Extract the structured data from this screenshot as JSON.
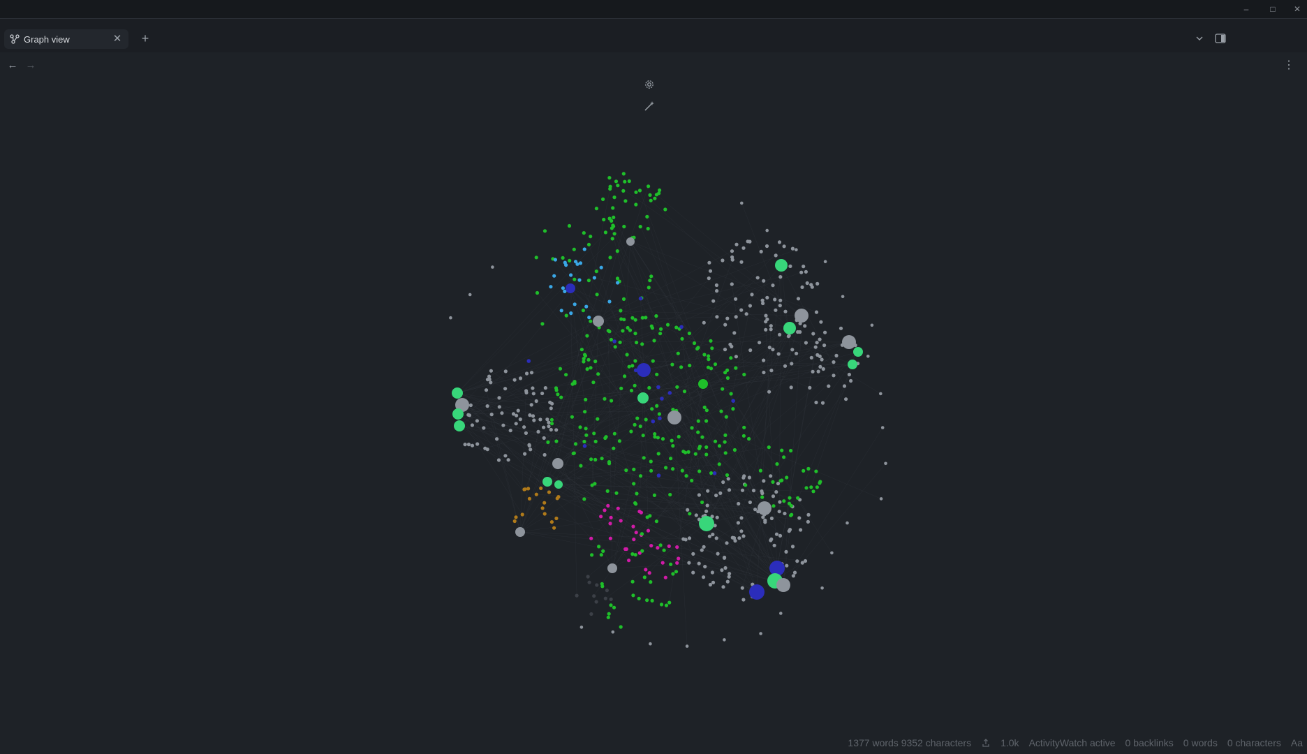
{
  "window": {
    "controls": {
      "minimize": "–",
      "maximize": "□",
      "close": "✕"
    }
  },
  "tabs": [
    {
      "title": "Graph view",
      "icon": "graph-icon",
      "close_symbol": "✕"
    }
  ],
  "tabbar": {
    "new_tab_symbol": "+",
    "dropdown_icon": "chevron-down-icon",
    "sidebar_icon": "sidebar-toggle-icon"
  },
  "nav": {
    "back_symbol": "←",
    "forward_symbol": "→",
    "more_symbol": "⋮"
  },
  "graph": {
    "settings_icon": "gear-icon",
    "animate_icon": "magic-wand-icon",
    "colors": {
      "default": "#8e949c",
      "green": "#1fbf2a",
      "mint": "#38d67a",
      "blue": "#2b2dbb",
      "lightblue": "#3aa7e6",
      "orange": "#b07a1a",
      "magenta": "#d11ba8",
      "dark": "#3c4047",
      "edge": "#3a3f47"
    }
  },
  "statusbar": {
    "word_count": "1377 words 9352 characters",
    "sync_icon": "sync-icon",
    "size": "1.0k",
    "activitywatch": "ActivityWatch active",
    "backlinks": "0 backlinks",
    "words": "0 words",
    "characters": "0 characters",
    "font_size_label": "Aa"
  }
}
